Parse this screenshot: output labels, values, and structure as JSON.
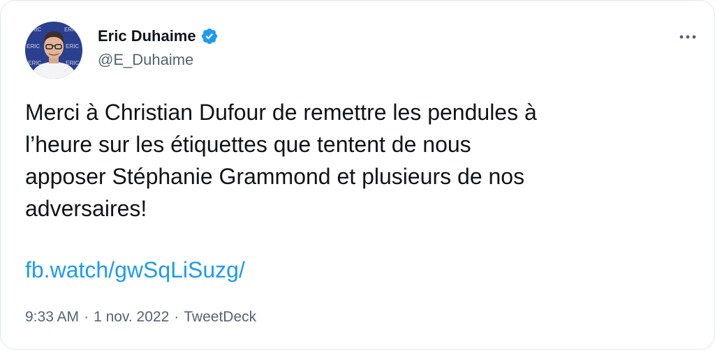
{
  "author": {
    "display_name": "Eric Duhaime",
    "handle": "@E_Duhaime",
    "avatar_icon": "person-portrait-icon",
    "avatar_banner_text": "ERIC DUHAIME",
    "verified_icon": "verified-badge-icon",
    "verified_color": "#1d9bf0"
  },
  "menu": {
    "more_icon": "more-horizontal-icon"
  },
  "tweet": {
    "text": "Merci à Christian Dufour de remettre les pendules à\nl’heure sur les étiquettes que tentent de nous\napposer Stéphanie Grammond et plusieurs de nos\nadversaires!",
    "link_text": "fb.watch/gwSqLiSuzg/",
    "link_color": "#1d9bf0"
  },
  "meta": {
    "time": "9:33 AM",
    "separator": "·",
    "date": "1 nov. 2022",
    "client": "TweetDeck"
  }
}
